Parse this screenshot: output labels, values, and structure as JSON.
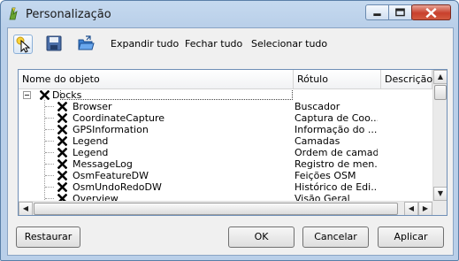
{
  "window": {
    "title": "Personalização"
  },
  "toolbar": {
    "expand_all": "Expandir tudo",
    "collapse_all": "Fechar tudo",
    "select_all": "Selecionar tudo"
  },
  "tree": {
    "columns": [
      "Nome do objeto",
      "Rótulo",
      "Descrição"
    ],
    "root": {
      "name": "Docks",
      "checked": true
    },
    "rows": [
      {
        "name": "Browser",
        "label": "Buscador",
        "checked": true
      },
      {
        "name": "CoordinateCapture",
        "label": "Captura de Coo...",
        "checked": true
      },
      {
        "name": "GPSInformation",
        "label": "Informação do ...",
        "checked": true
      },
      {
        "name": "Legend",
        "label": "Camadas",
        "checked": true
      },
      {
        "name": "Legend",
        "label": "Ordem de camada",
        "checked": true
      },
      {
        "name": "MessageLog",
        "label": "Registro de men...",
        "checked": true
      },
      {
        "name": "OsmFeatureDW",
        "label": "Feições OSM",
        "checked": true
      },
      {
        "name": "OsmUndoRedoDW",
        "label": "Histórico de Edi...",
        "checked": true
      },
      {
        "name": "Overview",
        "label": "Visão Geral",
        "checked": true
      }
    ]
  },
  "buttons": {
    "restore": "Restaurar",
    "ok": "OK",
    "cancel": "Cancelar",
    "apply": "Aplicar"
  },
  "icons": {
    "app": "qgis-icon",
    "pointer": "pointer-select-icon",
    "save": "floppy-save-icon",
    "open": "folder-open-icon",
    "check": "x-check-icon"
  }
}
